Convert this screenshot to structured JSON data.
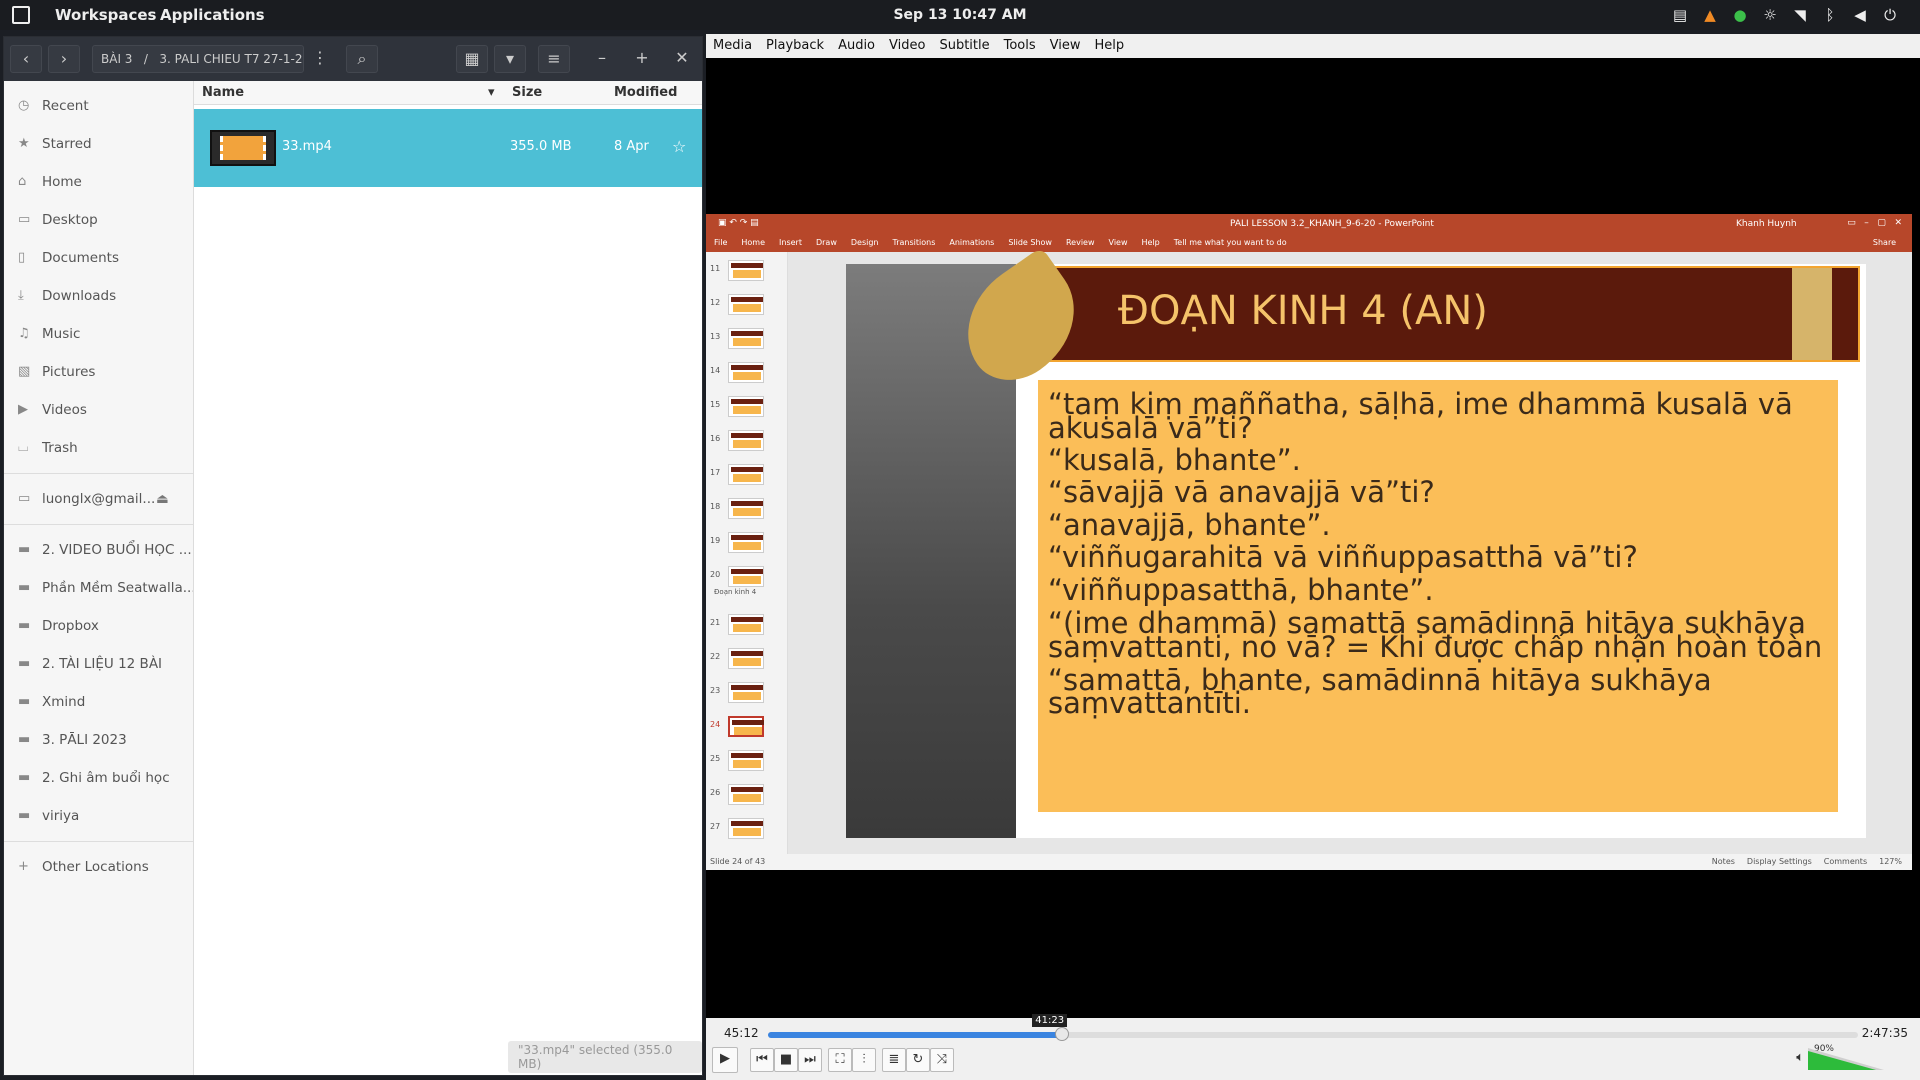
{
  "topbar": {
    "workspaces": "Workspaces",
    "applications": "Applications",
    "clock": "Sep 13  10:47 AM"
  },
  "fm": {
    "breadcrumb_parent": "BÀI 3",
    "breadcrumb_current": "3. PALI CHIEU T7 27-1-24",
    "sidebar": [
      {
        "label": "Recent",
        "icon": "clock-icon"
      },
      {
        "label": "Starred",
        "icon": "star-icon"
      },
      {
        "label": "Home",
        "icon": "home-icon"
      },
      {
        "label": "Desktop",
        "icon": "desktop-icon"
      },
      {
        "label": "Documents",
        "icon": "document-icon"
      },
      {
        "label": "Downloads",
        "icon": "download-icon"
      },
      {
        "label": "Music",
        "icon": "music-icon"
      },
      {
        "label": "Pictures",
        "icon": "picture-icon"
      },
      {
        "label": "Videos",
        "icon": "video-icon"
      },
      {
        "label": "Trash",
        "icon": "trash-icon"
      }
    ],
    "drive": "luonglx@gmail...",
    "bookmarks": [
      "2.  VIDEO BUỔI HỌC ...",
      "Phần Mềm Seatwalla...",
      "Dropbox",
      "2. TÀI LIỆU 12 BÀI",
      "Xmind",
      "3. PĀLI 2023",
      "2. Ghi âm buổi học",
      "viriya"
    ],
    "other_locations": "Other Locations",
    "columns": {
      "name": "Name",
      "size": "Size",
      "modified": "Modified"
    },
    "file": {
      "name": "33.mp4",
      "size": "355.0 MB",
      "modified": "8 Apr"
    },
    "status": "\"33.mp4\" selected  (355.0 MB)"
  },
  "vlc": {
    "menu": [
      "Media",
      "Playback",
      "Audio",
      "Video",
      "Subtitle",
      "Tools",
      "View",
      "Help"
    ],
    "time_current": "45:12",
    "time_total": "2:47:35",
    "seek_tooltip": "41:23",
    "progress_fraction": 0.27,
    "volume_label": "90%",
    "volume_fraction": 0.9
  },
  "ppt": {
    "title": "PALI LESSON 3.2_KHANH_9-6-20 - PowerPoint",
    "user": "Khanh Huynh",
    "ribbon": [
      "File",
      "Home",
      "Insert",
      "Draw",
      "Design",
      "Transitions",
      "Animations",
      "Slide Show",
      "Review",
      "View",
      "Help",
      "Tell me what you want to do"
    ],
    "share": "Share",
    "section": "Đoạn kinh 4",
    "slide_numbers": [
      "11",
      "12",
      "13",
      "14",
      "15",
      "16",
      "17",
      "18",
      "19",
      "20",
      "21",
      "22",
      "23",
      "24",
      "25",
      "26",
      "27"
    ],
    "status_left": "Slide 24 of 43",
    "status_right": [
      "Notes",
      "Display Settings",
      "Comments",
      "127%"
    ],
    "slide_title": "ĐOẠN KINH 4 (AN)",
    "lines": [
      "“taṃ kiṃ maññatha, sāḷhā, ime dhammā kusalā vā",
      "akusalā vā”ti?",
      "“kusalā, bhante”.",
      "“sāvajjā vā anavajjā vā”ti?",
      "“anavajjā, bhante”.",
      "“viññugarahitā vā viññuppasatthā vā”ti?",
      "“viññuppasatthā, bhante”.",
      "“(ime dhammā) samattā samādinnā hitāya sukhāya",
      "saṃvattanti, no vā? = Khi được chấp nhận hoàn toàn",
      "“samattā, bhante, samādinnā hitāya sukhāya",
      "saṃvattantīti."
    ]
  },
  "colors": {
    "selection": "#4dbfd5",
    "ppt_brand": "#b7472a",
    "seek": "#3a84e0",
    "textbox": "#fbbe58"
  }
}
